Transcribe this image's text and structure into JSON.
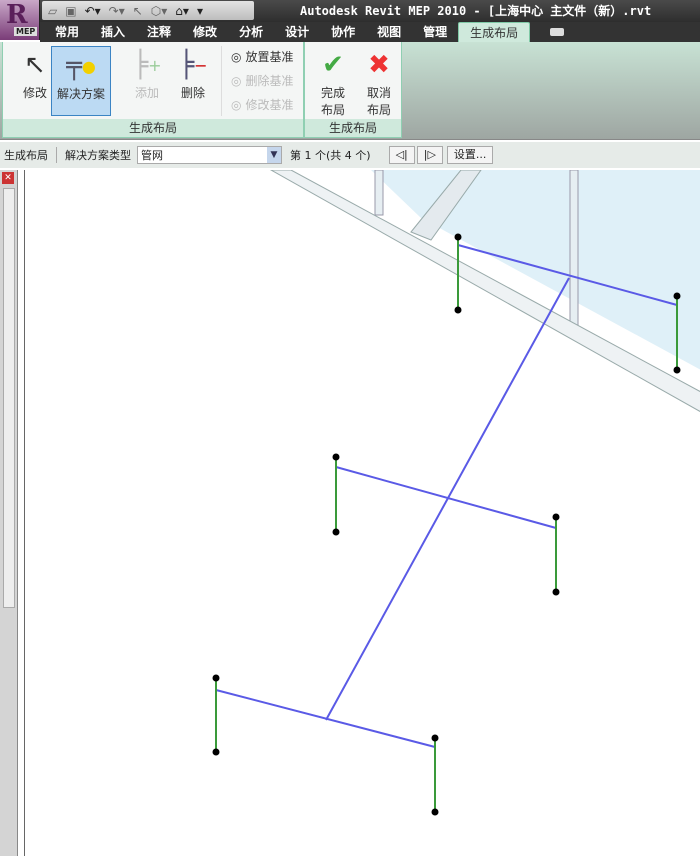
{
  "app": {
    "logo_text": "MEP",
    "title": "Autodesk Revit MEP 2010 - [上海中心 主文件（新）.rvt"
  },
  "tabs": [
    "常用",
    "插入",
    "注释",
    "修改",
    "分析",
    "设计",
    "协作",
    "视图",
    "管理",
    "生成布局"
  ],
  "active_tab": "生成布局",
  "ribbon": {
    "modify": "修改",
    "solutions": "解决方案",
    "add": "添加",
    "delete": "删除",
    "place_base": "放置基准",
    "delete_base": "删除基准",
    "modify_base": "修改基准",
    "finish_line1": "完成",
    "finish_line2": "布局",
    "cancel_line1": "取消",
    "cancel_line2": "布局",
    "panel1": "生成布局",
    "panel2": "生成布局"
  },
  "options": {
    "context": "生成布局",
    "type_label": "解决方案类型",
    "type_value": "管网",
    "counter": "第 1 个(共 4 个)",
    "prev": "◁|",
    "next": "|▷",
    "settings": "设置..."
  },
  "colors": {
    "layout_line": "#5a5ae6",
    "drop_line": "#3a9a3a",
    "glass": "#d8ecf7"
  }
}
